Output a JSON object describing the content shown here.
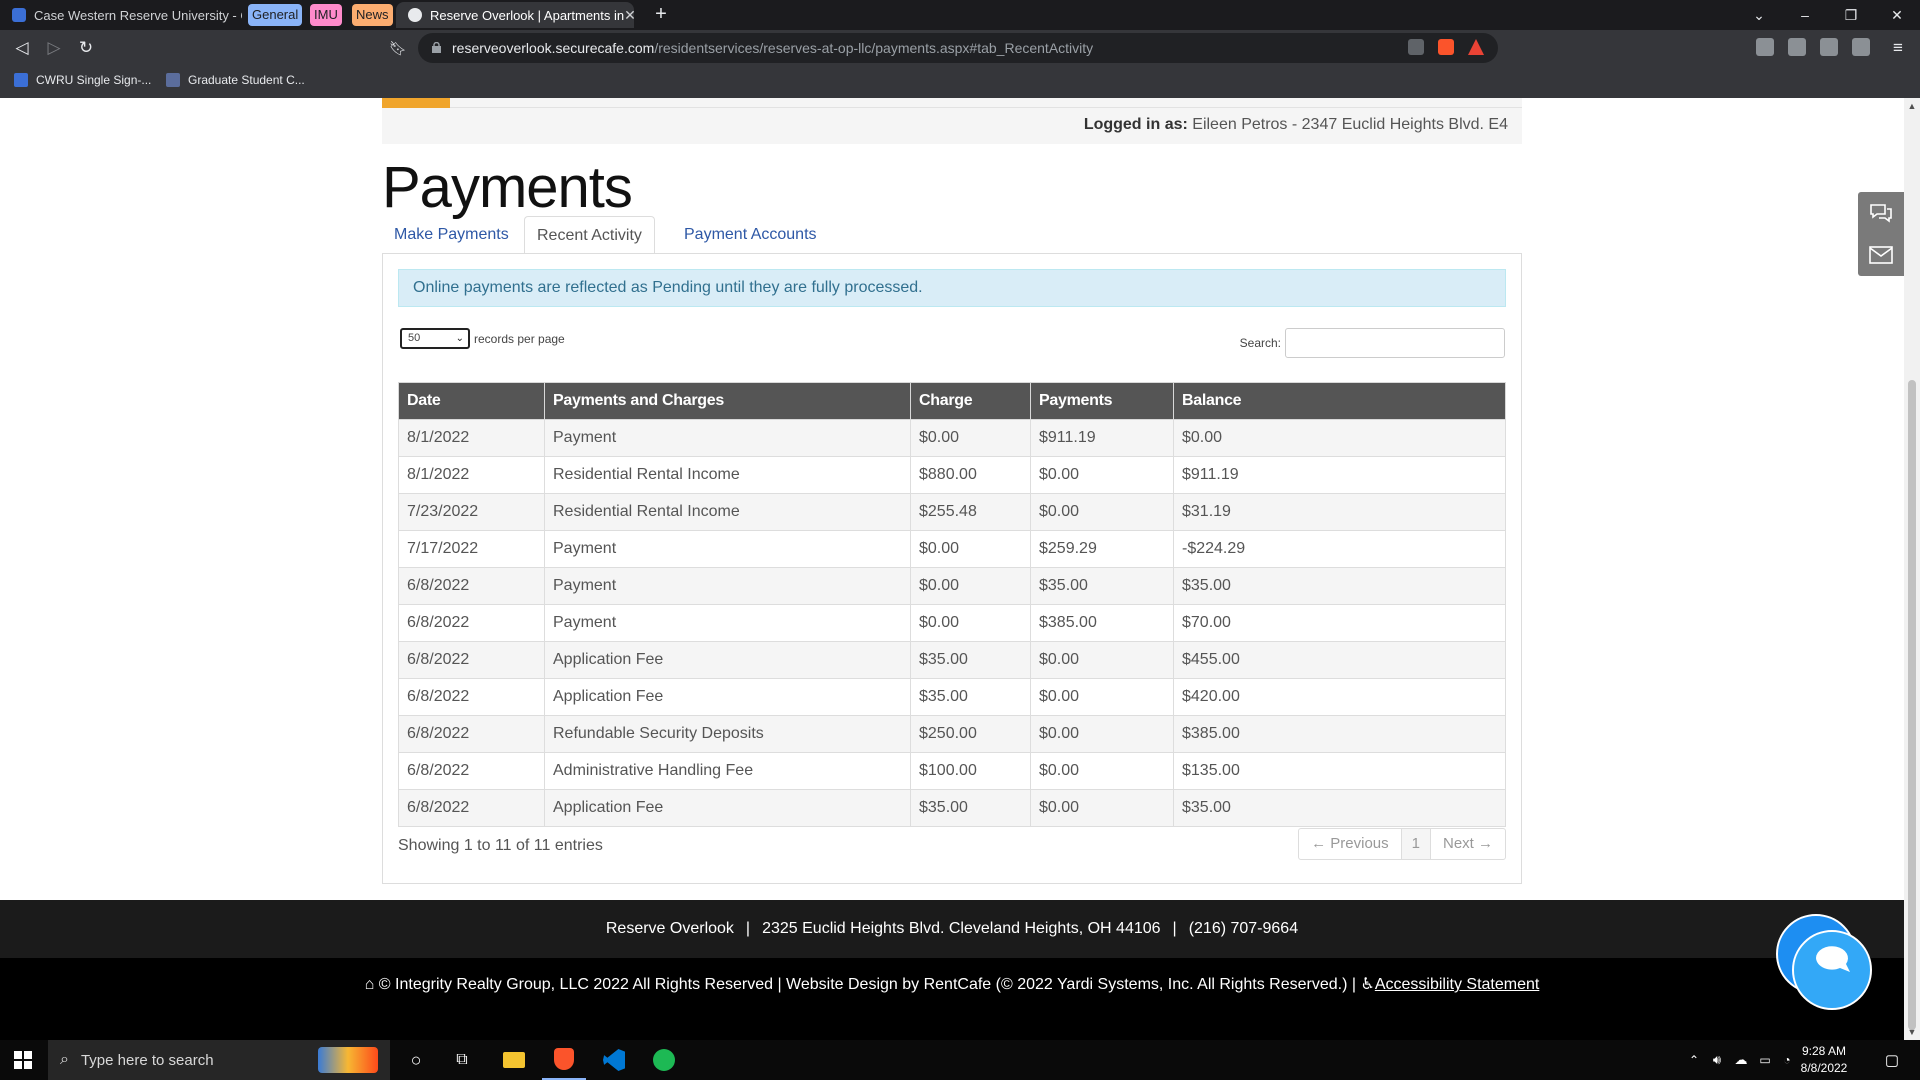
{
  "browser": {
    "tabs": [
      {
        "label": "Case Western Reserve University - Cale"
      },
      {
        "label": "Reserve Overlook | Apartments in"
      }
    ],
    "tab_groups": [
      {
        "label": "General",
        "color": "#8ab4f8"
      },
      {
        "label": "IMU",
        "color": "#ff8bcb"
      },
      {
        "label": "News",
        "color": "#fcad70"
      }
    ],
    "url": {
      "host": "reserveoverlook.securecafe.com",
      "path": "/residentservices/reserves-at-op-llc/payments.aspx#tab_RecentActivity"
    },
    "bookmarks": [
      {
        "label": "CWRU Single Sign-..."
      },
      {
        "label": "Graduate Student C..."
      }
    ]
  },
  "page": {
    "logged_in_label": "Logged in as:",
    "logged_in_value": "Eileen Petros - 2347 Euclid Heights Blvd. E4",
    "title": "Payments",
    "tabs": [
      {
        "label": "Make Payments"
      },
      {
        "label": "Recent Activity"
      },
      {
        "label": "Payment Accounts"
      }
    ],
    "alert": "Online payments are reflected as Pending until they are fully processed.",
    "length_value": "50",
    "length_suffix": "records per page",
    "search_label": "Search:",
    "table": {
      "columns": [
        "Date",
        "Payments and Charges",
        "Charge",
        "Payments",
        "Balance"
      ],
      "rows": [
        [
          "8/1/2022",
          "Payment",
          "$0.00",
          "$911.19",
          "$0.00"
        ],
        [
          "8/1/2022",
          "Residential Rental Income",
          "$880.00",
          "$0.00",
          "$911.19"
        ],
        [
          "7/23/2022",
          "Residential Rental Income",
          "$255.48",
          "$0.00",
          "$31.19"
        ],
        [
          "7/17/2022",
          "Payment",
          "$0.00",
          "$259.29",
          "-$224.29"
        ],
        [
          "6/8/2022",
          "Payment",
          "$0.00",
          "$35.00",
          "$35.00"
        ],
        [
          "6/8/2022",
          "Payment",
          "$0.00",
          "$385.00",
          "$70.00"
        ],
        [
          "6/8/2022",
          "Application Fee",
          "$35.00",
          "$0.00",
          "$455.00"
        ],
        [
          "6/8/2022",
          "Application Fee",
          "$35.00",
          "$0.00",
          "$420.00"
        ],
        [
          "6/8/2022",
          "Refundable Security Deposits",
          "$250.00",
          "$0.00",
          "$385.00"
        ],
        [
          "6/8/2022",
          "Administrative Handling Fee",
          "$100.00",
          "$0.00",
          "$135.00"
        ],
        [
          "6/8/2022",
          "Application Fee",
          "$35.00",
          "$0.00",
          "$35.00"
        ]
      ]
    },
    "info": "Showing 1 to 11 of 11 entries",
    "pager": {
      "prev": "← Previous",
      "current": "1",
      "next": "Next →"
    }
  },
  "footer": {
    "name": "Reserve Overlook",
    "address": "2325 Euclid Heights Blvd.  Cleveland Heights, OH 44106",
    "phone": "(216) 707-9664",
    "copyright": "© Integrity Realty Group, LLC 2022 All Rights Reserved | Website Design by RentCafe (© 2022 Yardi Systems, Inc. All Rights Reserved.) |",
    "accessibility": "Accessibility Statement"
  },
  "taskbar": {
    "search_placeholder": "Type here to search",
    "time": "9:28 AM",
    "date": "8/8/2022"
  },
  "colors": {
    "accent": "#f0a52c",
    "table_header": "#555555",
    "link": "#2e58a6",
    "chat": "#1d8ef2"
  }
}
